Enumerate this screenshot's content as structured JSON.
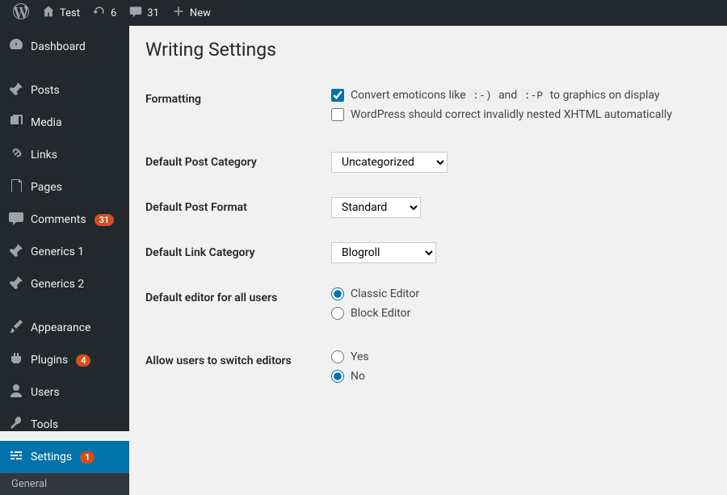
{
  "adminbar": {
    "site_name": "Test",
    "updates": "6",
    "comments": "31",
    "new_label": "New"
  },
  "sidebar": {
    "items": [
      {
        "label": "Dashboard"
      },
      {
        "label": "Posts"
      },
      {
        "label": "Media"
      },
      {
        "label": "Links"
      },
      {
        "label": "Pages"
      },
      {
        "label": "Comments",
        "badge": "31"
      },
      {
        "label": "Generics 1"
      },
      {
        "label": "Generics 2"
      },
      {
        "label": "Appearance"
      },
      {
        "label": "Plugins",
        "badge": "4"
      },
      {
        "label": "Users"
      },
      {
        "label": "Tools"
      },
      {
        "label": "Settings",
        "badge": "1"
      }
    ],
    "submenu": {
      "label": "General"
    }
  },
  "page": {
    "title": "Writing Settings",
    "formatting": {
      "label": "Formatting",
      "opt1_pre": "Convert emoticons like",
      "opt1_code1": ":-)",
      "opt1_mid": "and",
      "opt1_code2": ":-P",
      "opt1_post": "to graphics on display",
      "opt2": "WordPress should correct invalidly nested XHTML automatically"
    },
    "default_cat": {
      "label": "Default Post Category",
      "value": "Uncategorized"
    },
    "default_fmt": {
      "label": "Default Post Format",
      "value": "Standard"
    },
    "default_link_cat": {
      "label": "Default Link Category",
      "value": "Blogroll"
    },
    "default_editor": {
      "label": "Default editor for all users",
      "opt1": "Classic Editor",
      "opt2": "Block Editor"
    },
    "switch_editor": {
      "label": "Allow users to switch editors",
      "yes": "Yes",
      "no": "No"
    }
  }
}
